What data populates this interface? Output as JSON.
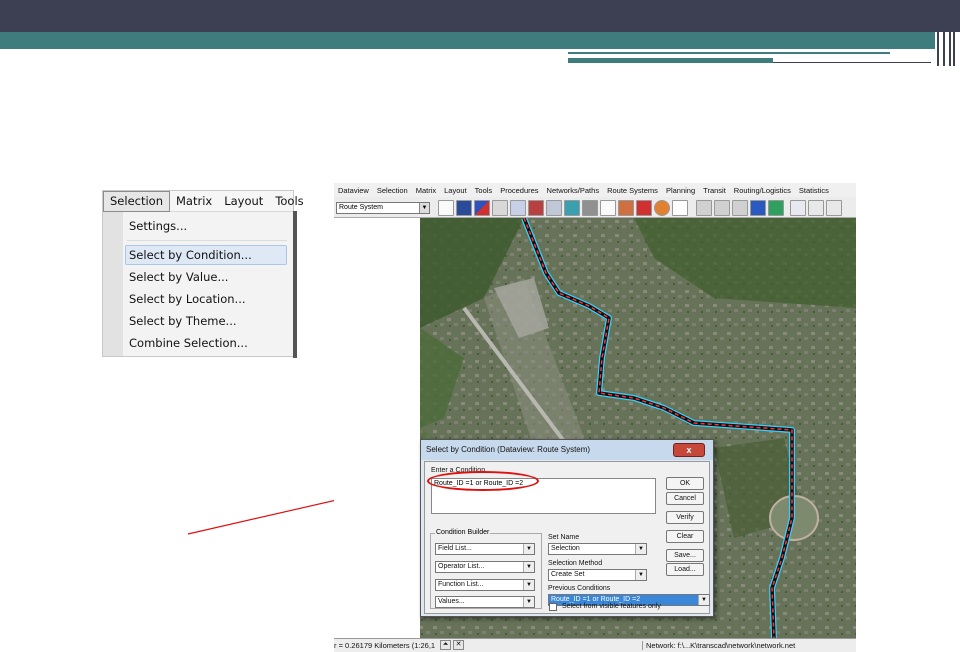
{
  "selection_menu": {
    "menubar": [
      "Selection",
      "Matrix",
      "Layout",
      "Tools"
    ],
    "items": [
      "Settings...",
      "Select by Condition...",
      "Select by Value...",
      "Select by Location...",
      "Select by Theme...",
      "Combine Selection..."
    ],
    "highlighted_item": "Select by Condition..."
  },
  "app": {
    "menubar": [
      "Dataview",
      "Selection",
      "Matrix",
      "Layout",
      "Tools",
      "Procedures",
      "Networks/Paths",
      "Route Systems",
      "Planning",
      "Transit",
      "Routing/Logistics",
      "Statistics"
    ],
    "layer_combo": "Route System",
    "status": {
      "scale": "r = 0.26179 Kilometers (1:26,1",
      "network": "Network: f:\\...K\\transcad\\network\\network.net"
    }
  },
  "dialog": {
    "title": "Select by Condition (Dataview: Route System)",
    "close_label": "x",
    "enter_condition_label": "Enter a Condition",
    "condition_text": "Route_ID =1 or Route_ID =2",
    "buttons": {
      "ok": "OK",
      "cancel": "Cancel",
      "verify": "Verify",
      "clear": "Clear",
      "save": "Save...",
      "load": "Load..."
    },
    "condition_builder_label": "Condition Builder",
    "field_list": "Field List...",
    "operator_list": "Operator List...",
    "function_list": "Function List...",
    "values": "Values...",
    "set_name_label": "Set Name",
    "set_name_value": "Selection",
    "selection_method_label": "Selection Method",
    "selection_method_value": "Create Set",
    "previous_conditions_label": "Previous Conditions",
    "previous_conditions_value": "Route_ID =1 or Route_ID =2",
    "visible_only_label": "Select from visible features only",
    "visible_only_checked": false
  },
  "colors": {
    "slide_dark": "#3d3f52",
    "slide_teal": "#3e7c7e",
    "annotation_red": "#e01010",
    "highlight_blue": "#3a86d8"
  },
  "icons": [
    "dropdown-arrow-icon",
    "map-toolbar-icons",
    "scroll-left-icon",
    "close-icon"
  ]
}
